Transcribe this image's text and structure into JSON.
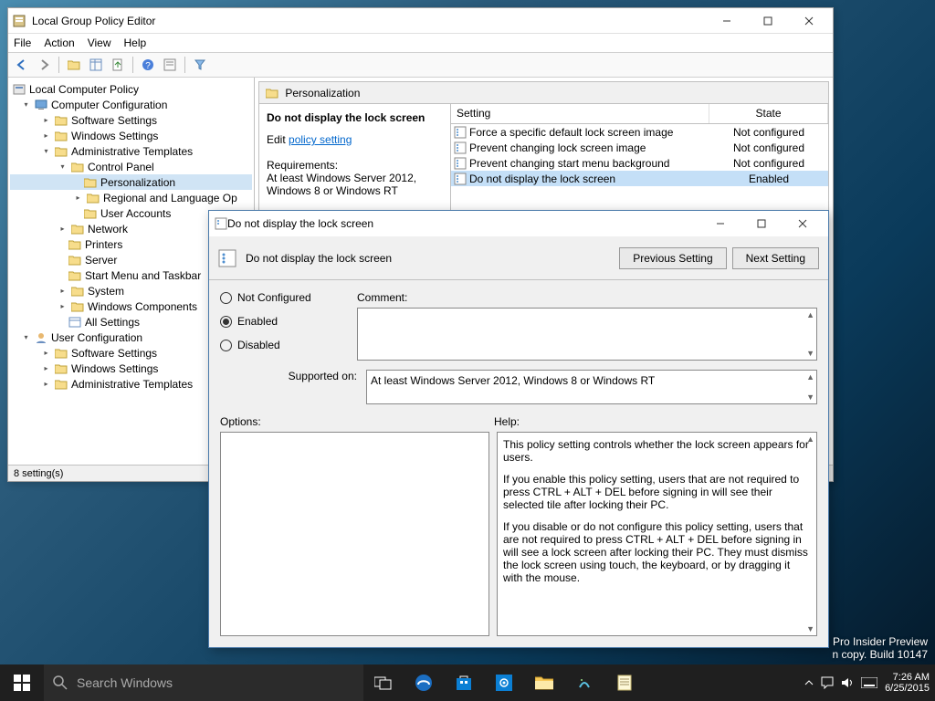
{
  "mainWindow": {
    "title": "Local Group Policy Editor",
    "menu": {
      "file": "File",
      "action": "Action",
      "view": "View",
      "help": "Help"
    },
    "statusbar": "8 setting(s)",
    "tree": {
      "root": "Local Computer Policy",
      "cc": "Computer Configuration",
      "ss1": "Software Settings",
      "ws1": "Windows Settings",
      "at1": "Administrative Templates",
      "cp": "Control Panel",
      "pers": "Personalization",
      "rlo": "Regional and Language Op",
      "ua": "User Accounts",
      "network": "Network",
      "printers": "Printers",
      "server": "Server",
      "smt": "Start Menu and Taskbar",
      "system": "System",
      "wc": "Windows Components",
      "all": "All Settings",
      "uc": "User Configuration",
      "ss2": "Software Settings",
      "ws2": "Windows Settings",
      "at2": "Administrative Templates"
    },
    "content": {
      "header": "Personalization",
      "selectedName": "Do not display the lock screen",
      "editLabel": "Edit ",
      "editLink": "policy setting",
      "requirementsLabel": "Requirements:",
      "requirementsText": "At least Windows Server 2012, Windows 8 or Windows RT",
      "listHeader": {
        "setting": "Setting",
        "state": "State"
      },
      "rows": [
        {
          "name": "Force a specific default lock screen image",
          "state": "Not configured"
        },
        {
          "name": "Prevent changing lock screen image",
          "state": "Not configured"
        },
        {
          "name": "Prevent changing start menu background",
          "state": "Not configured"
        },
        {
          "name": "Do not display the lock screen",
          "state": "Enabled"
        }
      ]
    }
  },
  "dialog": {
    "title": "Do not display the lock screen",
    "heading": "Do not display the lock screen",
    "prevBtn": "Previous Setting",
    "nextBtn": "Next Setting",
    "radios": {
      "nc": "Not Configured",
      "en": "Enabled",
      "dis": "Disabled"
    },
    "commentLabel": "Comment:",
    "supportedLabel": "Supported on:",
    "supportedText": "At least Windows Server 2012, Windows 8 or Windows RT",
    "optionsLabel": "Options:",
    "helpLabel": "Help:",
    "helpP1": "This policy setting controls whether the lock screen appears for users.",
    "helpP2": "If you enable this policy setting, users that are not required to press CTRL + ALT + DEL before signing in will see their selected tile after  locking their PC.",
    "helpP3": "If you disable or do not configure this policy setting, users that are not required to press CTRL + ALT + DEL before signing in will see a lock screen after locking their PC. They must dismiss the lock screen using touch, the keyboard, or by dragging it with the mouse."
  },
  "taskbar": {
    "searchPlaceholder": "Search Windows",
    "time": "7:26 AM",
    "date": "6/25/2015"
  },
  "watermark": {
    "line1": "Pro Insider Preview",
    "line2": "n copy. Build 10147"
  }
}
